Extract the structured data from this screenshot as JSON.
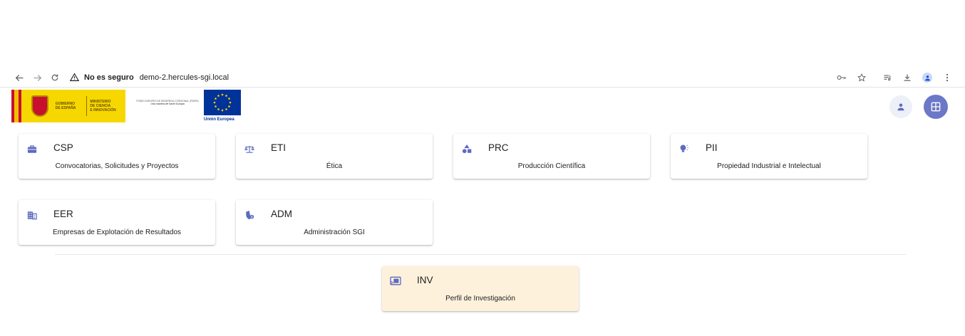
{
  "browser": {
    "security_label": "No es seguro",
    "url": "demo-2.hercules-sgi.local"
  },
  "header": {
    "gob_line1": "GOBIERNO",
    "gob_line2": "DE ESPAÑA",
    "min_line1": "MINISTERIO",
    "min_line2": "DE CIENCIA",
    "min_line3": "E INNOVACIÓN",
    "fondo_line1": "FONDO EUROPEO DE DESARROLLO REGIONAL (FEDER)",
    "fondo_line2": "Una manera de hacer Europa",
    "eu_label": "Unión Europea"
  },
  "modules": [
    {
      "code": "CSP",
      "name": "Convocatorias, Solicitudes y Proyectos",
      "icon": "briefcase-icon"
    },
    {
      "code": "ETI",
      "name": "Ética",
      "icon": "scale-icon"
    },
    {
      "code": "PRC",
      "name": "Producción Científica",
      "icon": "category-shapes-icon"
    },
    {
      "code": "PII",
      "name": "Propiedad Industrial e Intelectual",
      "icon": "lightbulb-icon"
    },
    {
      "code": "EER",
      "name": "Empresas de Explotación de Resultados",
      "icon": "building-icon"
    },
    {
      "code": "ADM",
      "name": "Administración SGI",
      "icon": "admin-shield-icon"
    },
    {
      "code": "INV",
      "name": "Perfil de Investigación",
      "icon": "screen-share-icon"
    }
  ],
  "colors": {
    "icon_accent": "#5c6bc0",
    "apps_button": "#6b78c7",
    "highlight_card": "#fef1dc"
  }
}
